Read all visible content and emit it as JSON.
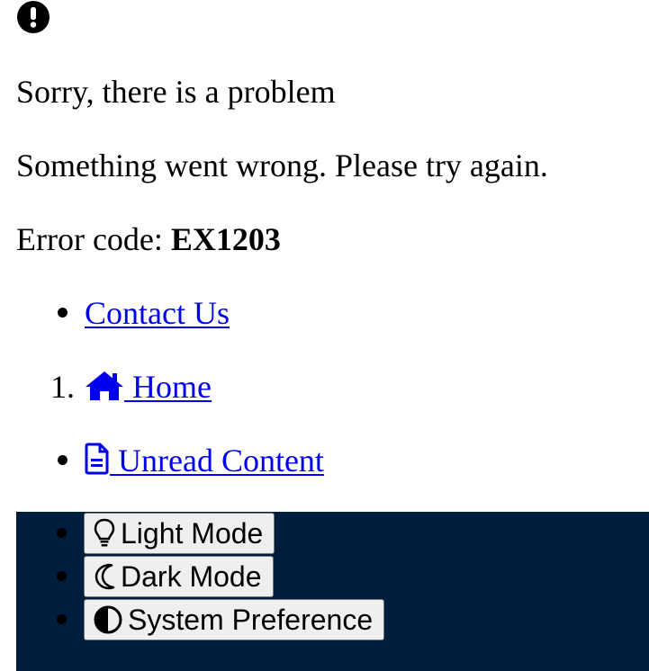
{
  "error": {
    "icon": "exclamation-circle-icon",
    "title": "Sorry, there is a problem",
    "message": "Something went wrong. Please try again.",
    "code_label": "Error code: ",
    "code_value": "EX1203"
  },
  "links": {
    "contact": {
      "label": "Contact Us"
    },
    "home": {
      "number": "1.",
      "label": " Home",
      "icon": "home-icon"
    },
    "unread": {
      "label": " Unread Content",
      "icon": "document-icon"
    }
  },
  "theme": {
    "background": "#001d3d",
    "buttons": [
      {
        "label": "Light Mode",
        "icon": "lightbulb-icon"
      },
      {
        "label": "Dark Mode",
        "icon": "moon-icon"
      },
      {
        "label": "System Preference",
        "icon": "half-circle-icon"
      }
    ]
  },
  "colors": {
    "link": "#0000ee",
    "button_bg": "#efefef"
  }
}
